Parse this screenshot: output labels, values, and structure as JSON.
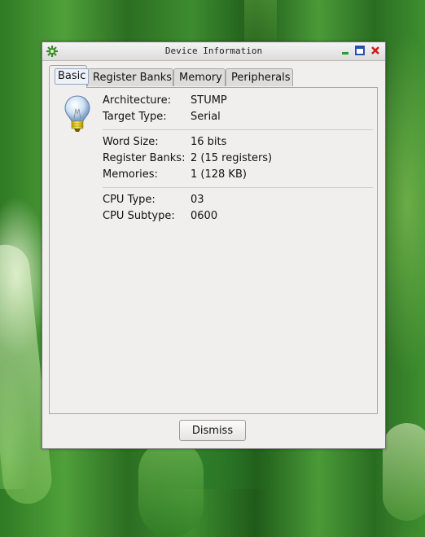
{
  "window": {
    "title": "Device Information",
    "tabs": [
      {
        "label": "Basic",
        "active": true
      },
      {
        "label": "Register Banks",
        "active": false
      },
      {
        "label": "Memory",
        "active": false
      },
      {
        "label": "Peripherals",
        "active": false
      }
    ]
  },
  "basic": {
    "group1": [
      {
        "label": "Architecture:",
        "value": "STUMP"
      },
      {
        "label": "Target Type:",
        "value": "Serial"
      }
    ],
    "group2": [
      {
        "label": "Word Size:",
        "value": "16 bits"
      },
      {
        "label": "Register Banks:",
        "value": "2 (15 registers)"
      },
      {
        "label": "Memories:",
        "value": "1 (128 KB)"
      }
    ],
    "group3": [
      {
        "label": "CPU Type:",
        "value": "03"
      },
      {
        "label": "CPU Subtype:",
        "value": "0600"
      }
    ]
  },
  "buttons": {
    "dismiss": "Dismiss"
  },
  "icons": {
    "app": "gear-app-icon",
    "info": "lightbulb-icon",
    "minimize": "minimize-icon",
    "maximize": "maximize-icon",
    "close": "close-icon"
  },
  "colors": {
    "close": "#cc1b1b",
    "minimize": "#28a028",
    "maximize": "#2a4fb0"
  }
}
